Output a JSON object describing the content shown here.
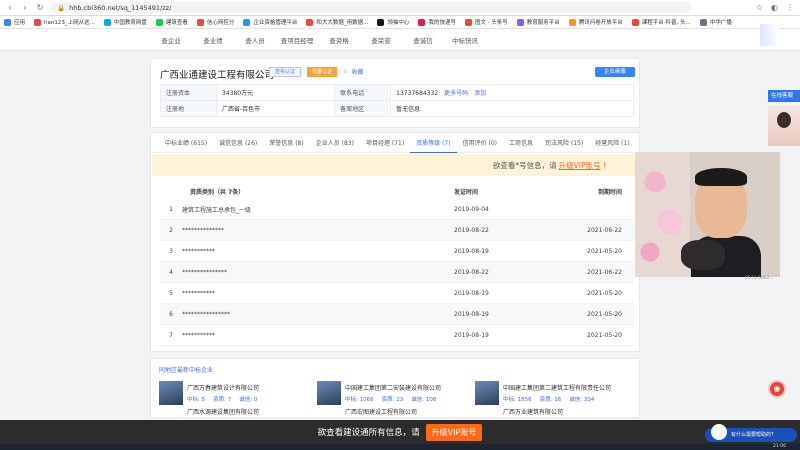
{
  "browser": {
    "url": "hhb.cbi360.net/sq_1145491/zz/",
    "bookmarks": [
      {
        "label": "应用",
        "color": "#3b82f6"
      },
      {
        "label": "han123_上网从这...",
        "color": "#e5484d"
      },
      {
        "label": "中国教育网盘",
        "color": "#0ea5e9"
      },
      {
        "label": "建筑查看",
        "color": "#22c55e"
      },
      {
        "label": "信心网控分",
        "color": "#ef4444"
      },
      {
        "label": "企业资格管理平台",
        "color": "#0ea5e9"
      },
      {
        "label": "和大大数据_用数据...",
        "color": "#ef4444"
      },
      {
        "label": "领袖中心",
        "color": "#111827"
      },
      {
        "label": "我的快递号",
        "color": "#e11d48"
      },
      {
        "label": "图文 · 头条号",
        "color": "#ef4444"
      },
      {
        "label": "教育服务平台",
        "color": "#8b5cf6"
      },
      {
        "label": "腾讯问卷开放平台",
        "color": "#f59e0b"
      },
      {
        "label": "课程平台·科普, 头...",
        "color": "#ef4444"
      },
      {
        "label": "中华广播·",
        "color": "#64748b"
      }
    ]
  },
  "sitenav": [
    "查企业",
    "查业绩",
    "查人员",
    "查项目经理",
    "查资格",
    "查荣誉",
    "查诚信",
    "中标快讯"
  ],
  "company": {
    "name": "广西业通建设工程有限公司",
    "tag_view": "查看认证",
    "tag_claim": "我要认证",
    "favorite": "收藏",
    "claim_button": "企业画像",
    "fields": [
      {
        "k": "注册资本",
        "v": "34380万元",
        "k2": "联系电话",
        "v2": "13737684332",
        "l1": "更多号码",
        "l2": "添加"
      },
      {
        "k": "注册地",
        "v": "广西省-百色市",
        "k2": "备案地区",
        "v2": "暂无信息",
        "l1": "",
        "l2": ""
      }
    ]
  },
  "tabs": [
    {
      "label": "中标业绩 (615)",
      "active": false
    },
    {
      "label": "诚信信息 (26)",
      "active": false
    },
    {
      "label": "荣誉信息 (8)",
      "active": false
    },
    {
      "label": "企业人员 (83)",
      "active": false
    },
    {
      "label": "项目经理 (71)",
      "active": false
    },
    {
      "label": "资质等级 (7)",
      "active": true
    },
    {
      "label": "信用评价 (0)",
      "active": false
    },
    {
      "label": "工商信息",
      "active": false
    },
    {
      "label": "司法风险 (15)",
      "active": false
    },
    {
      "label": "经营风险 (1)",
      "active": false
    }
  ],
  "vip_banner": {
    "text": "欲查看*号信息，请",
    "link": "升级VIP账号",
    "tail": "！"
  },
  "grid": {
    "head": {
      "name": "资质类别（共 7条）",
      "issue": "发证时间",
      "expire": "到期时间"
    },
    "rows": [
      {
        "no": "1",
        "name": "建筑工程施工总承包_一级",
        "issue": "2019-09-04",
        "expire": ""
      },
      {
        "no": "2",
        "name": "**************",
        "issue": "2019-08-22",
        "expire": "2021-06-22"
      },
      {
        "no": "3",
        "name": "***********",
        "issue": "2019-08-19",
        "expire": "2021-05-20"
      },
      {
        "no": "4",
        "name": "***************",
        "issue": "2019-08-22",
        "expire": "2021-06-22"
      },
      {
        "no": "5",
        "name": "***********",
        "issue": "2019-08-19",
        "expire": "2021-05-20"
      },
      {
        "no": "6",
        "name": "****************",
        "issue": "2019-08-19",
        "expire": "2021-05-20"
      },
      {
        "no": "7",
        "name": "***********",
        "issue": "2019-08-19",
        "expire": "2021-05-20"
      }
    ]
  },
  "related": {
    "title": "同地区最新中标企业",
    "items": [
      {
        "name": "广西万春建筑设计有限公司",
        "a": "中标: 5",
        "b": "资质: 7",
        "c": "诚信: 0"
      },
      {
        "name": "中国建工集团第二安装建设有限公司",
        "a": "中标: 1066",
        "b": "资质: 23",
        "c": "诚信: 108"
      },
      {
        "name": "中国建工集团第二建筑工程有限责任公司",
        "a": "中标: 1856",
        "b": "资质: 16",
        "c": "诚信: 334"
      }
    ],
    "row2": [
      "广西水源建设集团有限公司",
      "广西宏图建设工程有限公司",
      "广西万业建筑有限公司"
    ]
  },
  "side": {
    "online": "在线客服",
    "cam_label": "0571-5882..."
  },
  "subtitle": {
    "text": "欲查看建设通所有信息，请",
    "button": "升级VIP账号"
  },
  "helper": {
    "text": "有什么需要帮助的？"
  },
  "clock": "21:06"
}
